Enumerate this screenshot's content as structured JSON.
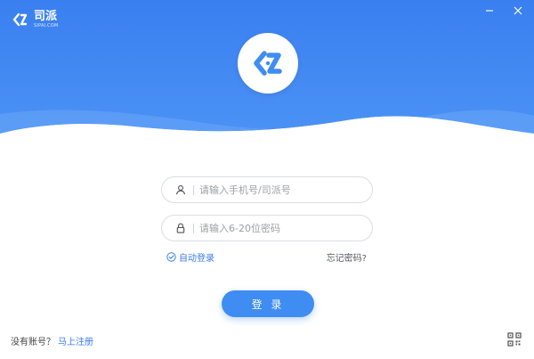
{
  "app": {
    "brand_name": "司派",
    "brand_domain": "SIPAI.COM"
  },
  "colors": {
    "primary": "#3f8cf3",
    "header_top": "#3a7ff0",
    "link": "#3a7de8"
  },
  "window": {
    "minimize_icon": "minimize-icon",
    "close_icon": "close-icon"
  },
  "form": {
    "phone_placeholder": "请输入手机号/司派号",
    "password_placeholder": "请输入6-20位密码",
    "auto_login_label": "自动登录",
    "auto_login_checked": true,
    "forgot_label": "忘记密码?",
    "login_button": "登 录"
  },
  "footer": {
    "no_account_text": "没有账号？",
    "register_link": "马上注册",
    "qr_icon": "qr-code-icon"
  }
}
